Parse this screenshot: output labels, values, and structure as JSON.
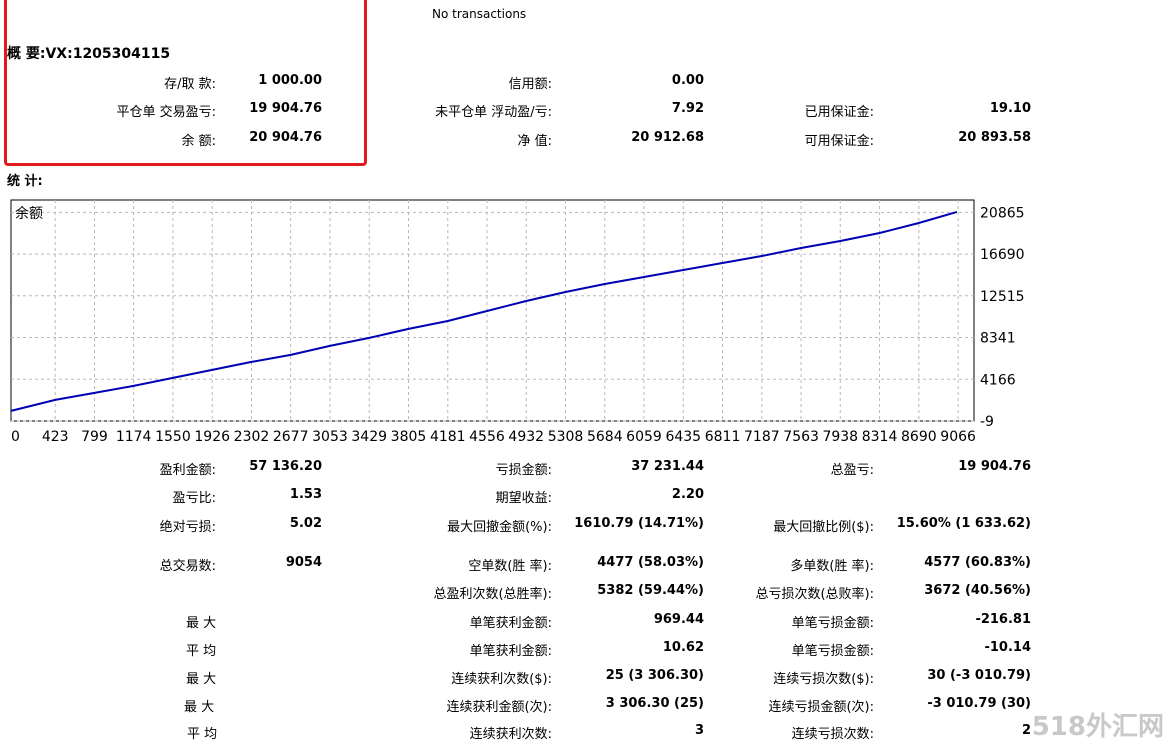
{
  "no_transactions": "No transactions",
  "summary": {
    "title": "概 要:VX:1205304115",
    "deposit_label": "存/取 款:",
    "deposit_value": "1 000.00",
    "closed_pl_label": "平仓单 交易盈亏:",
    "closed_pl_value": "19 904.76",
    "balance_label": "余 额:",
    "balance_value": "20 904.76",
    "credit_label": "信用额:",
    "credit_value": "0.00",
    "floating_label": "未平仓单 浮动盈/亏:",
    "floating_value": "7.92",
    "equity_label": "净 值:",
    "equity_value": "20 912.68",
    "margin_label": "已用保证金:",
    "margin_value": "19.10",
    "free_margin_label": "可用保证金:",
    "free_margin_value": "20 893.58"
  },
  "stats_title": "统 计:",
  "chart_data": {
    "type": "line",
    "series_label": "余额",
    "line_color": "#0000b4",
    "grid": true,
    "x_ticks": [
      "0",
      "423",
      "799",
      "1174",
      "1550",
      "1926",
      "2302",
      "2677",
      "3053",
      "3429",
      "3805",
      "4181",
      "4556",
      "4932",
      "5308",
      "5684",
      "6059",
      "6435",
      "6811",
      "7187",
      "7563",
      "7938",
      "8314",
      "8690",
      "9066"
    ],
    "y_ticks": [
      "20865",
      "16690",
      "12515",
      "8341",
      "4166",
      "-9"
    ],
    "xlim": [
      0,
      9218
    ],
    "ylim": [
      -9,
      22100
    ],
    "x": [
      0,
      423,
      799,
      1174,
      1550,
      1926,
      2302,
      2677,
      3053,
      3429,
      3805,
      4181,
      4556,
      4932,
      5308,
      5684,
      6059,
      6435,
      6811,
      7187,
      7563,
      7938,
      8314,
      8690,
      9054
    ],
    "y": [
      1000,
      2100,
      2800,
      3500,
      4300,
      5100,
      5900,
      6600,
      7500,
      8300,
      9200,
      10000,
      11000,
      12000,
      12900,
      13700,
      14400,
      15100,
      15800,
      16500,
      17300,
      18000,
      18800,
      19800,
      20904.76
    ]
  },
  "stats": {
    "gross_profit_label": "盈利金额:",
    "gross_profit_value": "57 136.20",
    "gross_loss_label": "亏损金额:",
    "gross_loss_value": "37 231.44",
    "net_profit_label": "总盈亏:",
    "net_profit_value": "19 904.76",
    "profit_factor_label": "盈亏比:",
    "profit_factor_value": "1.53",
    "expected_payoff_label": "期望收益:",
    "expected_payoff_value": "2.20",
    "abs_drawdown_label": "绝对亏损:",
    "abs_drawdown_value": "5.02",
    "max_drawdown_label": "最大回撤金额(%):",
    "max_drawdown_value": "1610.79 (14.71%)",
    "rel_drawdown_label": "最大回撤比例($):",
    "rel_drawdown_value": "15.60% (1 633.62)",
    "total_trades_label": "总交易数:",
    "total_trades_value": "9054",
    "short_label": "空单数(胜 率):",
    "short_value": "4477 (58.03%)",
    "long_label": "多单数(胜 率):",
    "long_value": "4577 (60.83%)",
    "profit_trades_label": "总盈利次数(总胜率):",
    "profit_trades_value": "5382 (59.44%)",
    "loss_trades_label": "总亏损次数(总败率):",
    "loss_trades_value": "3672 (40.56%)",
    "largest_label": "最 大",
    "largest_profit_label": "单笔获利金额:",
    "largest_profit_value": "969.44",
    "largest_loss_label": "单笔亏损金额:",
    "largest_loss_value": "-216.81",
    "average_label": "平 均",
    "avg_profit_label": "单笔获利金额:",
    "avg_profit_value": "10.62",
    "avg_loss_label": "单笔亏损金额:",
    "avg_loss_value": "-10.14",
    "max_label": "最 大",
    "max_consec_wins_label": "连续获利次数($):",
    "max_consec_wins_value": "25 (3 306.30)",
    "max_consec_losses_label": "连续亏损次数($):",
    "max_consec_losses_value": "30 (-3 010.79)",
    "max2_label": "最 大",
    "max_consec_profit_label": "连续获利金额(次):",
    "max_consec_profit_value": "3 306.30 (25)",
    "max_consec_loss_label": "连续亏损金额(次):",
    "max_consec_loss_value": "-3 010.79 (30)",
    "avg2_label": "平 均",
    "avg_consec_wins_label": "连续获利次数:",
    "avg_consec_wins_value": "3",
    "avg_consec_losses_label": "连续亏损次数:",
    "avg_consec_losses_value": "2"
  },
  "watermark": "518外汇网"
}
